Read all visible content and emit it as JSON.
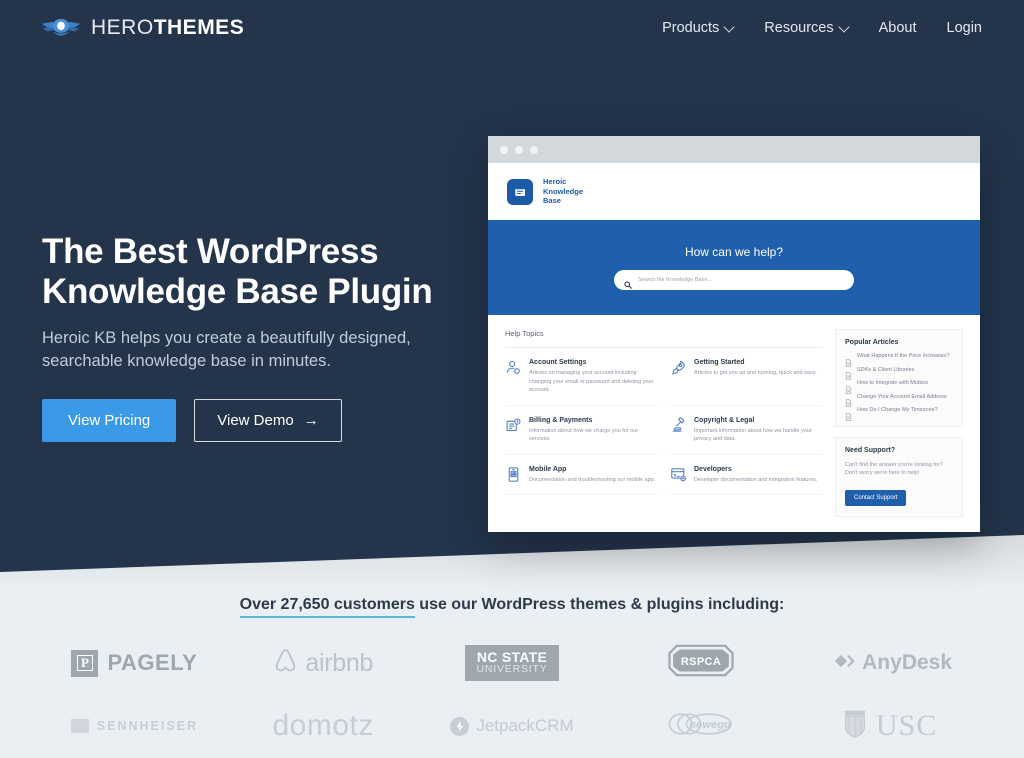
{
  "header": {
    "logo": {
      "part1": "HERO",
      "part2": "THEMES",
      "icon": "winged-shield-logo-icon"
    },
    "nav": [
      {
        "label": "Products",
        "has_caret": true
      },
      {
        "label": "Resources",
        "has_caret": true
      },
      {
        "label": "About",
        "has_caret": false
      },
      {
        "label": "Login",
        "has_caret": false
      }
    ]
  },
  "hero": {
    "title_line1": "The Best WordPress",
    "title_line2": "Knowledge Base Plugin",
    "subtitle": "Heroic KB helps you create a beautifully designed, searchable knowledge base in minutes.",
    "primary_button": "View Pricing",
    "secondary_button": "View Demo",
    "secondary_button_arrow": "→",
    "background_color": "#23344b",
    "primary_button_color": "#3b9ae8"
  },
  "mockup": {
    "brand": {
      "line1": "Heroic",
      "line2": "Knowledge",
      "line3": "Base",
      "icon": "book-app-icon",
      "color": "#1c5aa8"
    },
    "search": {
      "heading": "How can we help?",
      "placeholder": "Search the Knowledge Base...",
      "icon": "search-icon",
      "band_color": "#1f5fab"
    },
    "help_topics_label": "Help Topics",
    "topics": [
      {
        "icon": "user-gear-icon",
        "title": "Account Settings",
        "desc": "Articles on managing your account including changing your email or password and deleting your account."
      },
      {
        "icon": "rocket-icon",
        "title": "Getting Started",
        "desc": "Articles to get you up and running, quick and easy."
      },
      {
        "icon": "invoice-icon",
        "title": "Billing & Payments",
        "desc": "Information about how we charge you for our services."
      },
      {
        "icon": "gavel-icon",
        "title": "Copyright & Legal",
        "desc": "Important information about how we handle your privacy and data."
      },
      {
        "icon": "mobile-phone-icon",
        "title": "Mobile App",
        "desc": "Documentation and troubleshooting our mobile app."
      },
      {
        "icon": "code-window-icon",
        "title": "Developers",
        "desc": "Developer documentation and integration features."
      }
    ],
    "popular": {
      "heading": "Popular Articles",
      "articles": [
        "What Happens If the Price Increases?",
        "SDKs & Client Libraries",
        "How to Integrate with Mobiso",
        "Change Your Account Email Address",
        "How Do I Change My Timezone?"
      ]
    },
    "support": {
      "heading": "Need Support?",
      "desc": "Can't find the answer you're looking for? Don't worry we're here to help!",
      "button": "Contact Support"
    }
  },
  "customers": {
    "headline_highlight": "Over 27,650 customers",
    "headline_rest": " use our WordPress themes & plugins including:",
    "underline_color": "#5bb8d4",
    "row1": [
      {
        "name": "Pagely",
        "text": "PAGELY",
        "mark": "P"
      },
      {
        "name": "Airbnb",
        "text": "airbnb"
      },
      {
        "name": "NC State University",
        "text_line1": "NC STATE",
        "text_line2": "UNIVERSITY"
      },
      {
        "name": "RSPCA",
        "text": "RSPCA"
      },
      {
        "name": "AnyDesk",
        "text": "AnyDesk"
      }
    ],
    "row2": [
      {
        "name": "Sennheiser",
        "text": "SENNHEISER"
      },
      {
        "name": "Domotz",
        "text": "domotz"
      },
      {
        "name": "JetpackCRM",
        "text": "JetpackCRM"
      },
      {
        "name": "Newegg",
        "text": "newegg"
      },
      {
        "name": "USC",
        "text": "USC"
      }
    ]
  }
}
